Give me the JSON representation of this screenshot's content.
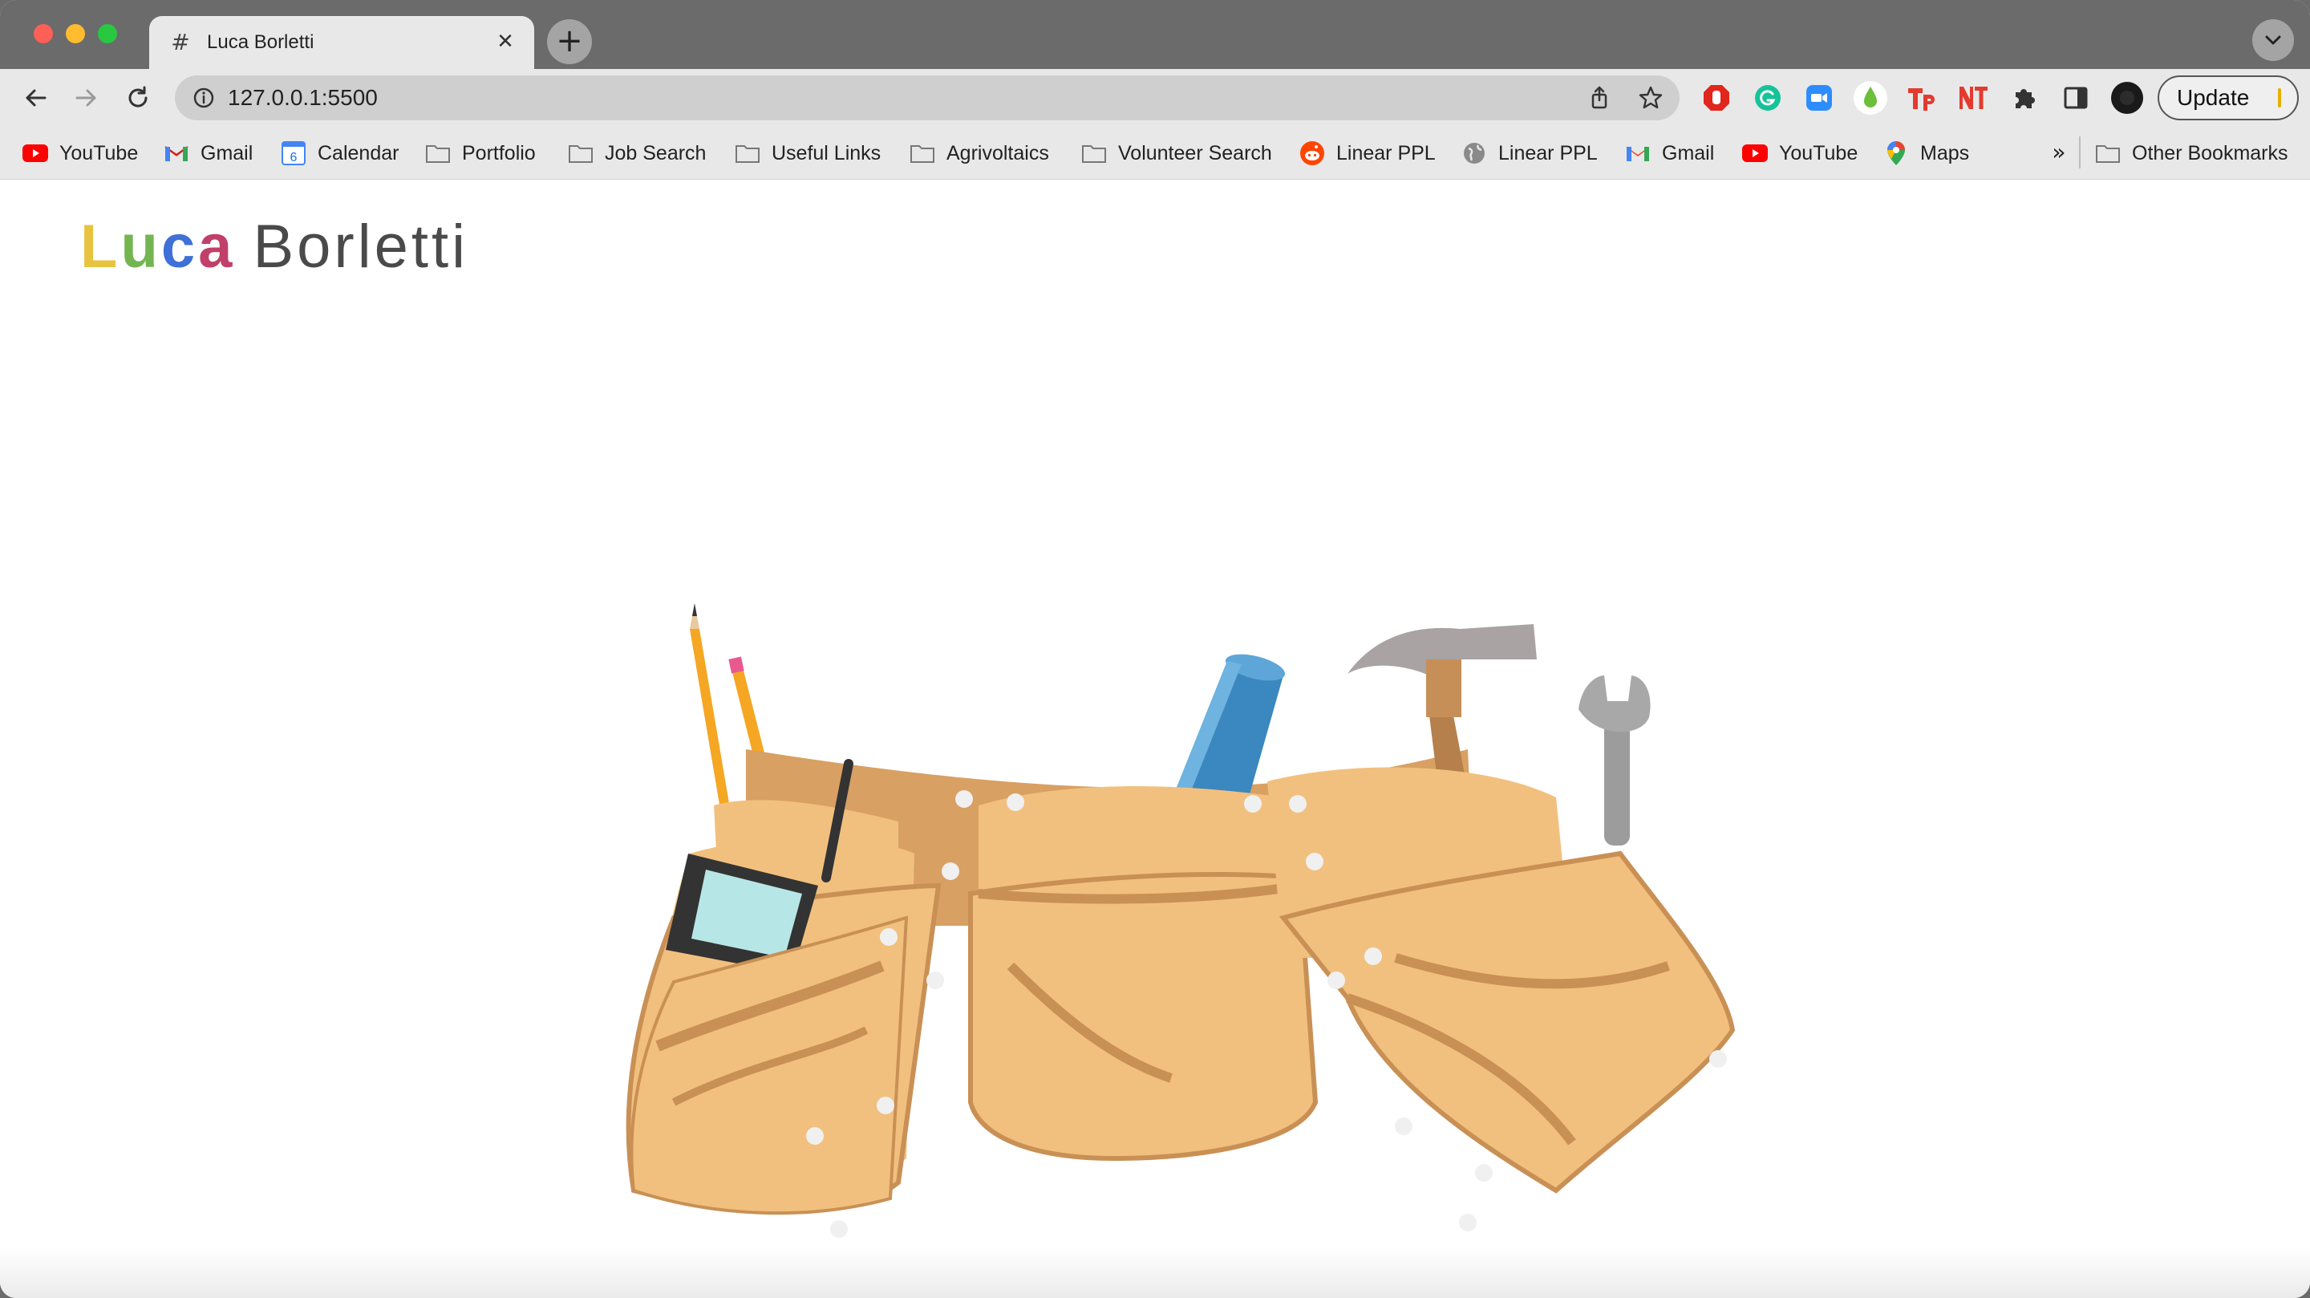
{
  "window": {
    "tab": {
      "title": "Luca Borletti",
      "favicon_glyph": "#",
      "close_glyph": "✕"
    },
    "new_tab_glyph": "+"
  },
  "toolbar": {
    "url": "127.0.0.1:5500",
    "update_label": "Update"
  },
  "bookmarks": {
    "items": [
      {
        "label": "YouTube",
        "icon": "youtube-icon"
      },
      {
        "label": "Gmail",
        "icon": "gmail-icon"
      },
      {
        "label": "Calendar",
        "icon": "calendar-icon"
      },
      {
        "label": "Portfolio",
        "icon": "folder-icon"
      },
      {
        "label": "Job Search",
        "icon": "folder-icon"
      },
      {
        "label": "Useful Links",
        "icon": "folder-icon"
      },
      {
        "label": "Agrivoltaics",
        "icon": "folder-icon"
      },
      {
        "label": "Volunteer Search",
        "icon": "folder-icon"
      },
      {
        "label": "Linear PPL",
        "icon": "reddit-icon"
      },
      {
        "label": "Linear PPL",
        "icon": "globe-icon"
      },
      {
        "label": "Gmail",
        "icon": "gmail-icon"
      },
      {
        "label": "YouTube",
        "icon": "youtube-icon"
      },
      {
        "label": "Maps",
        "icon": "maps-pin-icon"
      }
    ],
    "overflow_glyph": "»",
    "other": {
      "label": "Other Bookmarks",
      "icon": "folder-icon"
    },
    "calendar_day": "6"
  },
  "page": {
    "logo": {
      "first_letters": [
        "L",
        "u",
        "c",
        "a"
      ],
      "first_colors": [
        "#e8c33f",
        "#74b552",
        "#3f70d8",
        "#c0406a"
      ],
      "last": "Borletti"
    },
    "hero": {
      "icon": "tool-belt-icon"
    }
  },
  "colors": {
    "chrome_dark": "#6b6b6b",
    "chrome_light": "#e8e8e8",
    "omnibox": "#cfcfcf",
    "leather_light": "#f2c07e",
    "leather_dark": "#c99055",
    "blueprint": "#3b87c0"
  }
}
